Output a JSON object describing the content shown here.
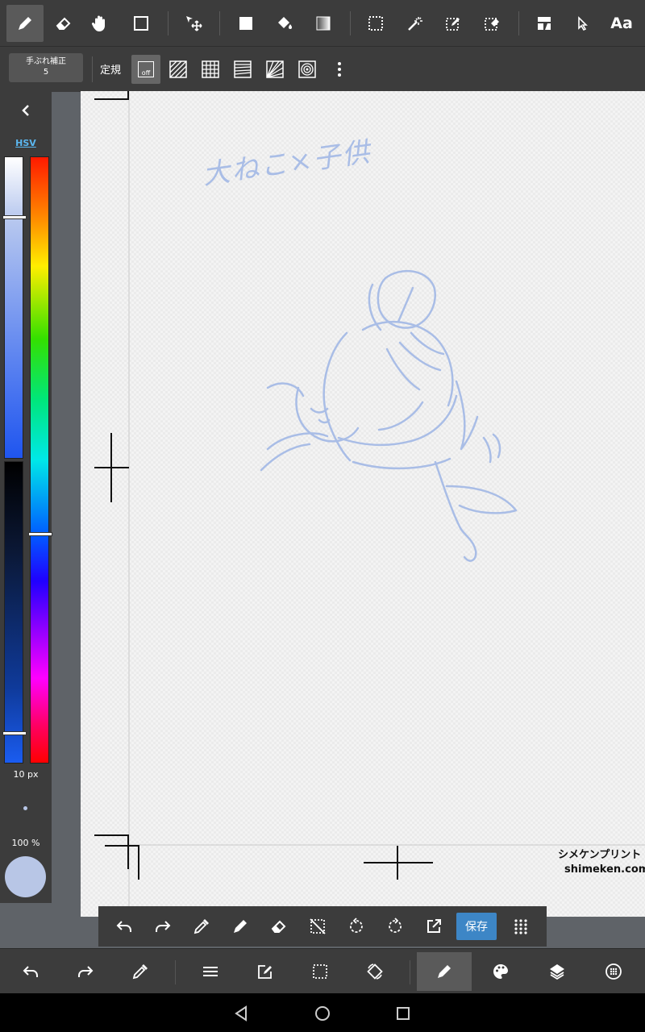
{
  "top_toolbar": {
    "tools": [
      "pen-icon",
      "eraser-icon",
      "hand-icon",
      "shape-icon",
      "move-icon",
      "fill-rect-icon",
      "bucket-icon",
      "gradient-icon",
      "select-rect-icon",
      "magic-wand-icon",
      "select-pen-icon",
      "select-eraser-icon",
      "frame-icon",
      "cursor-icon",
      "text-icon"
    ],
    "text_tool_label": "Aa"
  },
  "ruler_bar": {
    "stabilizer_label": "手ぶれ補正",
    "stabilizer_value": "5",
    "ruler_label": "定規",
    "ruler_off_label": "off"
  },
  "color_panel": {
    "mode_label": "HSV",
    "brush_size": "10 px",
    "opacity": "100 %",
    "current_color": "#b8c6e6"
  },
  "canvas": {
    "sketch_note": "大ねこ×子供",
    "watermark_jp": "シメケンプリント",
    "watermark_url": "shimeken.com",
    "sketch_color": "#a9bde6"
  },
  "float_bar": {
    "save_label": "保存"
  },
  "bottom_bar": {
    "tools": [
      "undo-icon",
      "redo-icon",
      "eyedropper-icon",
      "menu-icon",
      "edit-icon",
      "selection-icon",
      "rotate-canvas-icon",
      "brush-icon",
      "palette-icon",
      "layers-icon",
      "material-icon"
    ]
  },
  "colors": {
    "toolbar_bg": "#3c3c3c",
    "accent_blue": "#3d86c6",
    "hsv_label": "#5bb7f0"
  }
}
